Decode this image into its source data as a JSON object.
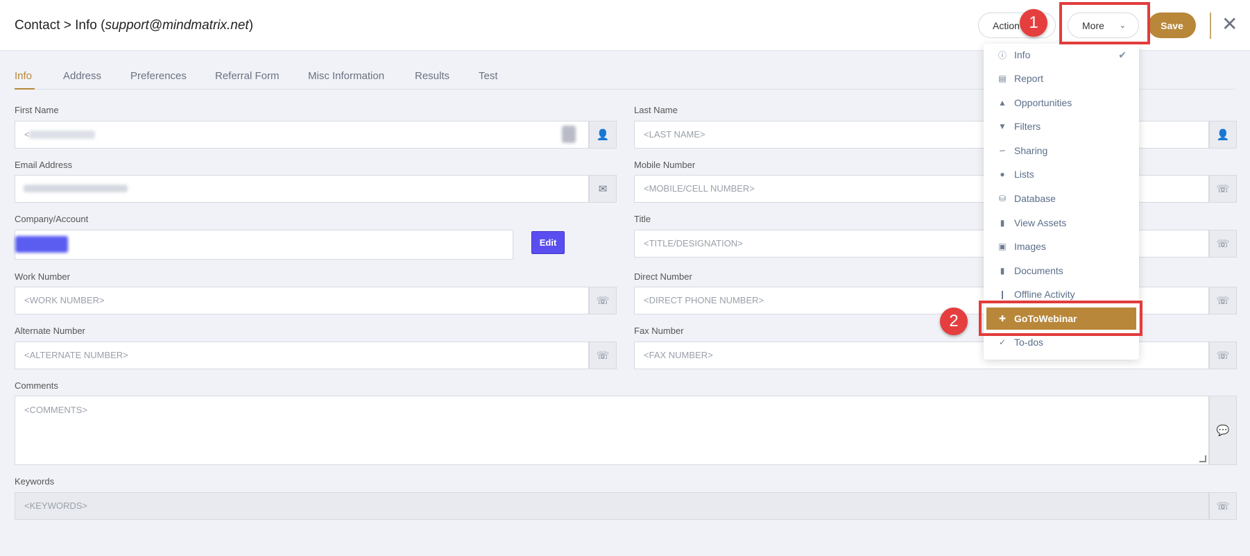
{
  "header": {
    "title_prefix": "Contact > Info (",
    "title_email": "support@mindmatrix.net",
    "title_suffix": ")",
    "action_label": "Action",
    "more_label": "More",
    "save_label": "Save"
  },
  "tabs": [
    {
      "label": "Info",
      "active": true
    },
    {
      "label": "Address"
    },
    {
      "label": "Preferences"
    },
    {
      "label": "Referral Form"
    },
    {
      "label": "Misc Information"
    },
    {
      "label": "Results"
    },
    {
      "label": "Test"
    }
  ],
  "form": {
    "first_name": {
      "label": "First Name",
      "placeholder": "<"
    },
    "last_name": {
      "label": "Last Name",
      "placeholder": "<LAST NAME>"
    },
    "email": {
      "label": "Email Address"
    },
    "mobile": {
      "label": "Mobile Number",
      "placeholder": "<MOBILE/CELL NUMBER>"
    },
    "company": {
      "label": "Company/Account",
      "edit_label": "Edit"
    },
    "title": {
      "label": "Title",
      "placeholder": "<TITLE/DESIGNATION>"
    },
    "work": {
      "label": "Work Number",
      "placeholder": "<WORK NUMBER>"
    },
    "direct": {
      "label": "Direct Number",
      "placeholder": "<DIRECT PHONE NUMBER>"
    },
    "alternate": {
      "label": "Alternate Number",
      "placeholder": "<ALTERNATE NUMBER>"
    },
    "fax": {
      "label": "Fax Number",
      "placeholder": "<FAX NUMBER>"
    },
    "comments": {
      "label": "Comments",
      "placeholder": "<COMMENTS>"
    },
    "keywords": {
      "label": "Keywords",
      "placeholder": "<KEYWORDS>"
    }
  },
  "dropdown": {
    "items": [
      {
        "label": "Info",
        "icon": "info-icon",
        "checked": true
      },
      {
        "label": "Report",
        "icon": "chart-icon"
      },
      {
        "label": "Opportunities",
        "icon": "shapes-icon"
      },
      {
        "label": "Filters",
        "icon": "filter-icon"
      },
      {
        "label": "Sharing",
        "icon": "share-icon"
      },
      {
        "label": "Lists",
        "icon": "users-icon"
      },
      {
        "label": "Database",
        "icon": "database-icon"
      },
      {
        "label": "View Assets",
        "icon": "file-icon"
      },
      {
        "label": "Images",
        "icon": "image-icon"
      },
      {
        "label": "Documents",
        "icon": "document-icon"
      },
      {
        "label": "Offline Activity",
        "icon": "person-icon"
      },
      {
        "label": "GoToWebinar",
        "icon": "puzzle-icon",
        "highlighted": true
      },
      {
        "label": "To-dos",
        "icon": "check-circle-icon"
      }
    ]
  },
  "callouts": {
    "one": "1",
    "two": "2"
  },
  "colors": {
    "accent": "#b8873a",
    "callout": "#e23c3c",
    "edit_button": "#5b4ef0"
  }
}
